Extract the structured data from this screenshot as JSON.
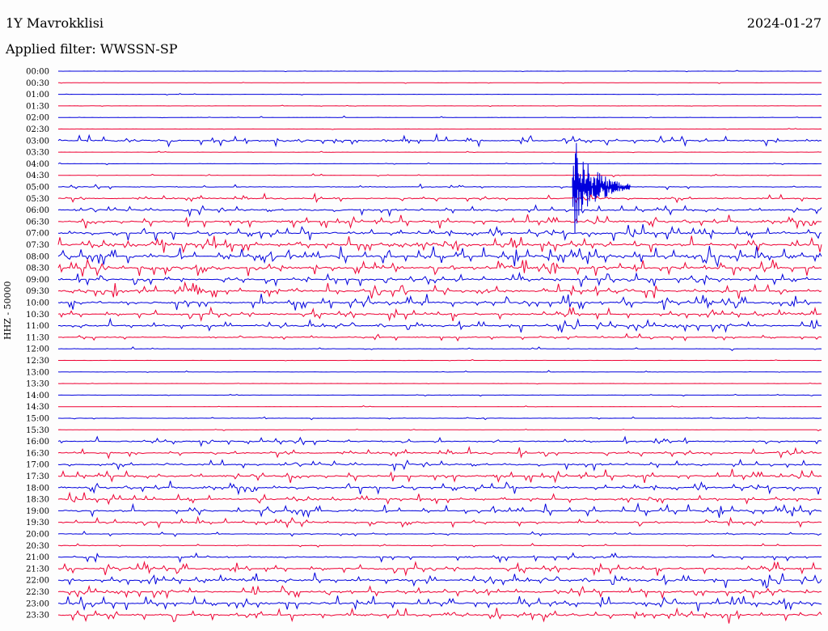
{
  "header": {
    "station": "1Y Mavrokklisi",
    "date": "2024-01-27",
    "filter": "Applied filter: WWSSN-SP"
  },
  "channel_label": "HHZ - 50000",
  "colors": {
    "odd_trace": "#0000dd",
    "even_trace": "#ee0033"
  },
  "chart_data": {
    "type": "line",
    "description_kind": "helicorder",
    "y_tick_labels": [
      "00:00",
      "00:30",
      "01:00",
      "01:30",
      "02:00",
      "02:30",
      "03:00",
      "03:30",
      "04:00",
      "04:30",
      "05:00",
      "05:30",
      "06:00",
      "06:30",
      "07:00",
      "07:30",
      "08:00",
      "08:30",
      "09:00",
      "09:30",
      "10:00",
      "10:30",
      "11:00",
      "11:30",
      "12:00",
      "12:30",
      "13:00",
      "13:30",
      "14:00",
      "14:30",
      "15:00",
      "15:30",
      "16:00",
      "16:30",
      "17:00",
      "17:30",
      "18:00",
      "18:30",
      "19:00",
      "19:30",
      "20:00",
      "20:30",
      "21:00",
      "21:30",
      "22:00",
      "22:30",
      "23:00",
      "23:30"
    ],
    "series": [
      {
        "values": [
          0.1
        ]
      },
      {
        "values": [
          0.1
        ]
      },
      {
        "values": [
          0.1
        ]
      },
      {
        "values": [
          0.1
        ]
      },
      {
        "values": [
          0.15
        ]
      },
      {
        "values": [
          0.1
        ]
      },
      {
        "values": [
          0.6
        ]
      },
      {
        "values": [
          0.1
        ]
      },
      {
        "values": [
          0.1
        ]
      },
      {
        "values": [
          0.15
        ]
      },
      {
        "values": [
          0.3
        ]
      },
      {
        "values": [
          0.5
        ]
      },
      {
        "values": [
          0.6
        ]
      },
      {
        "values": [
          0.7
        ]
      },
      {
        "values": [
          0.8
        ]
      },
      {
        "values": [
          1.0
        ]
      },
      {
        "values": [
          1.0
        ]
      },
      {
        "values": [
          0.9
        ]
      },
      {
        "values": [
          0.7
        ]
      },
      {
        "values": [
          0.8
        ]
      },
      {
        "values": [
          0.8
        ]
      },
      {
        "values": [
          0.7
        ]
      },
      {
        "values": [
          0.7
        ]
      },
      {
        "values": [
          0.4
        ]
      },
      {
        "values": [
          0.2
        ]
      },
      {
        "values": [
          0.1
        ]
      },
      {
        "values": [
          0.15
        ]
      },
      {
        "values": [
          0.1
        ]
      },
      {
        "values": [
          0.1
        ]
      },
      {
        "values": [
          0.1
        ]
      },
      {
        "values": [
          0.15
        ]
      },
      {
        "values": [
          0.1
        ]
      },
      {
        "values": [
          0.5
        ]
      },
      {
        "values": [
          0.6
        ]
      },
      {
        "values": [
          0.6
        ]
      },
      {
        "values": [
          0.7
        ]
      },
      {
        "values": [
          0.7
        ]
      },
      {
        "values": [
          0.6
        ]
      },
      {
        "values": [
          0.7
        ]
      },
      {
        "values": [
          0.5
        ]
      },
      {
        "values": [
          0.3
        ]
      },
      {
        "values": [
          0.2
        ]
      },
      {
        "values": [
          0.5
        ]
      },
      {
        "values": [
          0.7
        ]
      },
      {
        "values": [
          0.8
        ]
      },
      {
        "values": [
          0.7
        ]
      },
      {
        "values": [
          0.8
        ]
      },
      {
        "values": [
          0.8
        ]
      }
    ]
  }
}
